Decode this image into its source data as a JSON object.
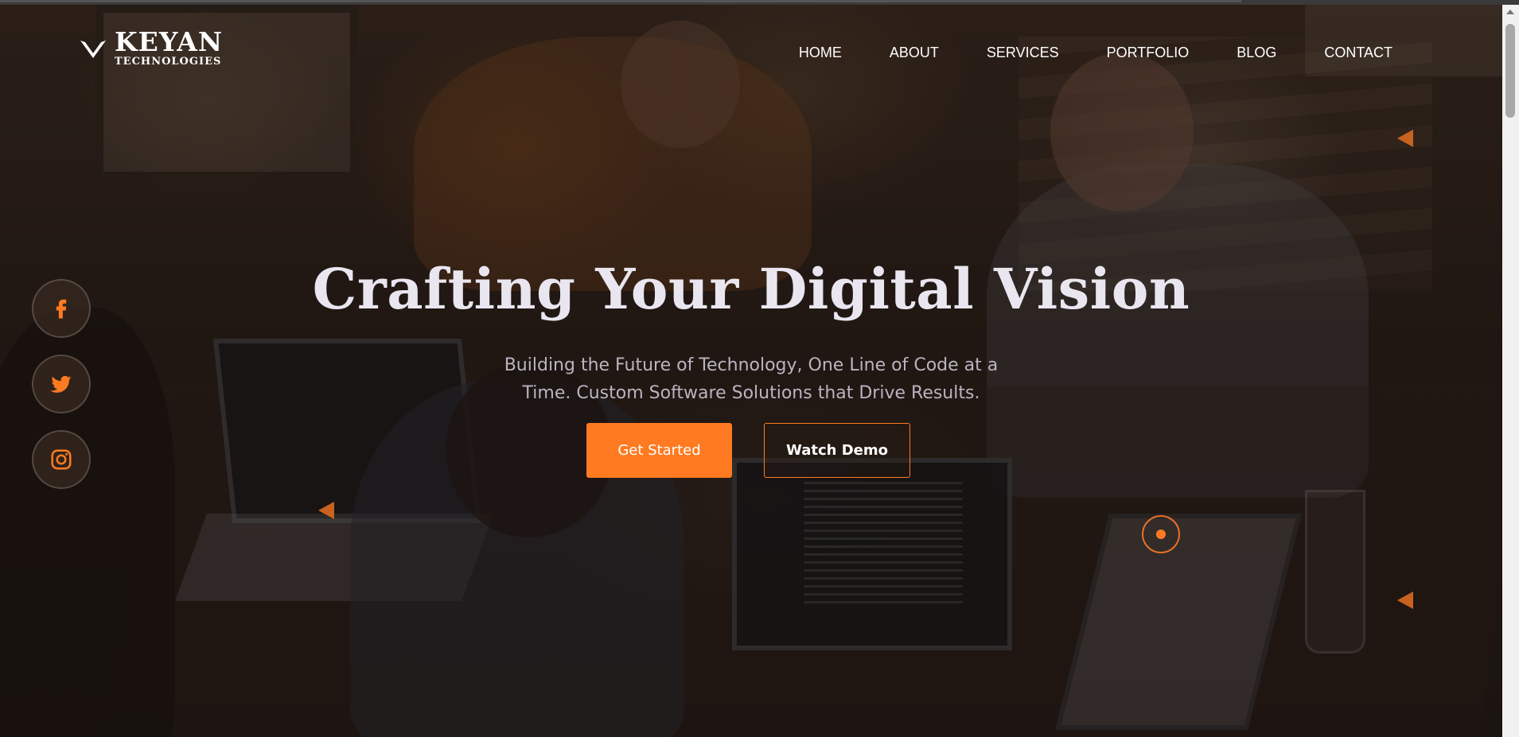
{
  "brand": {
    "name": "KEYAN",
    "subtitle": "TECHNOLOGIES"
  },
  "nav": {
    "items": [
      {
        "label": "HOME"
      },
      {
        "label": "ABOUT"
      },
      {
        "label": "SERVICES"
      },
      {
        "label": "PORTFOLIO"
      },
      {
        "label": "BLOG"
      },
      {
        "label": "CONTACT"
      }
    ]
  },
  "social": [
    {
      "icon": "facebook-icon"
    },
    {
      "icon": "twitter-icon"
    },
    {
      "icon": "instagram-icon"
    }
  ],
  "hero": {
    "title": "Crafting Your Digital Vision",
    "subtitle": "Building the Future of Technology, One Line of Code at a Time. Custom Software Solutions that Drive Results.",
    "primary_button": "Get Started",
    "secondary_button": "Watch Demo"
  },
  "colors": {
    "accent": "#ff7a21",
    "title": "#e9e6f0",
    "subtitle": "#b9b4c0"
  }
}
